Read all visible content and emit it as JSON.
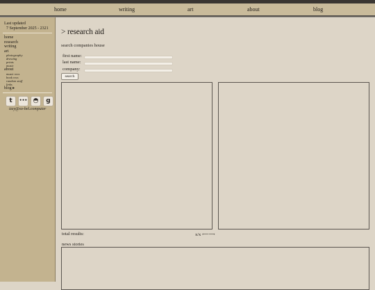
{
  "topnav": {
    "items": [
      "home",
      "writing",
      "art",
      "about",
      "blog"
    ]
  },
  "sidebar": {
    "updated_label": "Last updated",
    "updated_date": "7 September 2025 - 2321",
    "nav": {
      "home": "home",
      "research": "research",
      "writing": "writing",
      "art": "art",
      "art_sub": [
        "photography",
        "drawing",
        "prints",
        "music"
      ],
      "about": "about",
      "about_sub": [
        "music recs",
        "book recs",
        "random stuff",
        "links"
      ],
      "blog": "blog ▸"
    },
    "icons": [
      {
        "name": "tumblr-icon",
        "glyph": "t"
      },
      {
        "name": "more-icon",
        "glyph": "•••"
      },
      {
        "name": "discord-icon",
        "glyph": "◓"
      },
      {
        "name": "goodreads-icon",
        "glyph": "g"
      }
    ],
    "email": "izzy@so-bel.computer"
  },
  "main": {
    "title": "> research aid",
    "subtitle": "search companies house",
    "form": {
      "first_name_label": "first name:",
      "last_name_label": "last name:",
      "company_label": "company:",
      "first_name_value": "",
      "last_name_value": "",
      "company_value": "",
      "search_label": "search"
    },
    "results_label": "total results:",
    "pager": {
      "value": "x/x",
      "prev": "⟵",
      "next": "⟶"
    },
    "news_label": "news stories"
  }
}
